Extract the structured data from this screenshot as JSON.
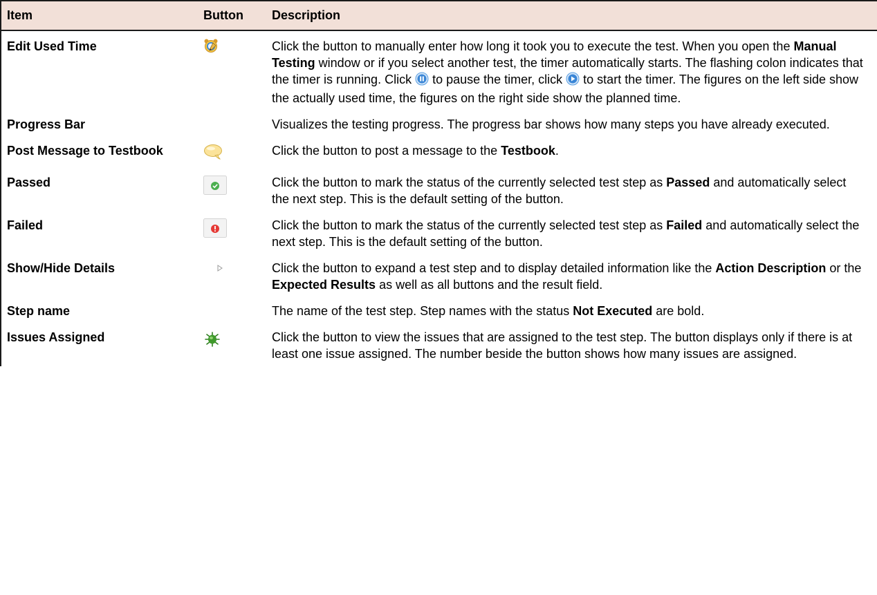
{
  "header": {
    "item": "Item",
    "button": "Button",
    "description": "Description"
  },
  "rows": [
    {
      "item": "Edit Used Time",
      "icon": "alarm-clock-edit-icon",
      "desc": {
        "p1": "Click the button to manually enter how long it took you to execute the test. When you open the ",
        "b1": "Manual Testing",
        "p2": " window or if you select another test, the timer automatically starts. The flashing colon indicates that the timer is running. Click ",
        "p3": " to pause the timer, click ",
        "p4": " to start the timer. The figures on the left side show the actually used time, the figures on the right side show the planned time."
      }
    },
    {
      "item": "Progress Bar",
      "icon": "",
      "desc": {
        "p1": "Visualizes the testing progress. The progress bar shows how many steps you have already executed."
      }
    },
    {
      "item": "Post Message to Testbook",
      "icon": "speech-bubble-icon",
      "desc": {
        "p1": "Click the button to post a message to the ",
        "b1": "Testbook",
        "p2": "."
      }
    },
    {
      "item": "Passed",
      "icon": "passed-check-icon",
      "desc": {
        "p1": "Click the button to mark the status of the currently selected test step as ",
        "b1": "Passed",
        "p2": " and automatically select the next step. This is the default setting of the button."
      }
    },
    {
      "item": "Failed",
      "icon": "failed-exclamation-icon",
      "desc": {
        "p1": "Click the button to mark the status of the currently selected test step as ",
        "b1": "Failed",
        "p2": " and automatically select the next step. This is the default setting of the button."
      }
    },
    {
      "item": "Show/Hide Details",
      "icon": "expand-triangle-icon",
      "desc": {
        "p1": "Click the button to expand a test step and to display detailed information like the ",
        "b1": "Action Description",
        "p2": " or the ",
        "b2": "Expected Results",
        "p3": " as well as all buttons and the result field."
      }
    },
    {
      "item": "Step name",
      "icon": "",
      "desc": {
        "p1": "The name of the test step. Step names with the status ",
        "b1": "Not Executed",
        "p2": " are bold."
      }
    },
    {
      "item": "Issues Assigned",
      "icon": "bug-icon",
      "desc": {
        "p1": "Click the button to view the issues that are assigned to the test step. The button displays only if there is at least one issue assigned. The number beside the button shows how many issues are assigned."
      }
    }
  ],
  "colors": {
    "header_bg": "#f2e0d8",
    "border": "#1a1a1a",
    "pass_green": "#4caf50",
    "fail_red": "#e53935",
    "timer_blue": "#3a86d6",
    "bubble_yellow": "#fbe39a",
    "bug_green": "#3f9a2c"
  }
}
